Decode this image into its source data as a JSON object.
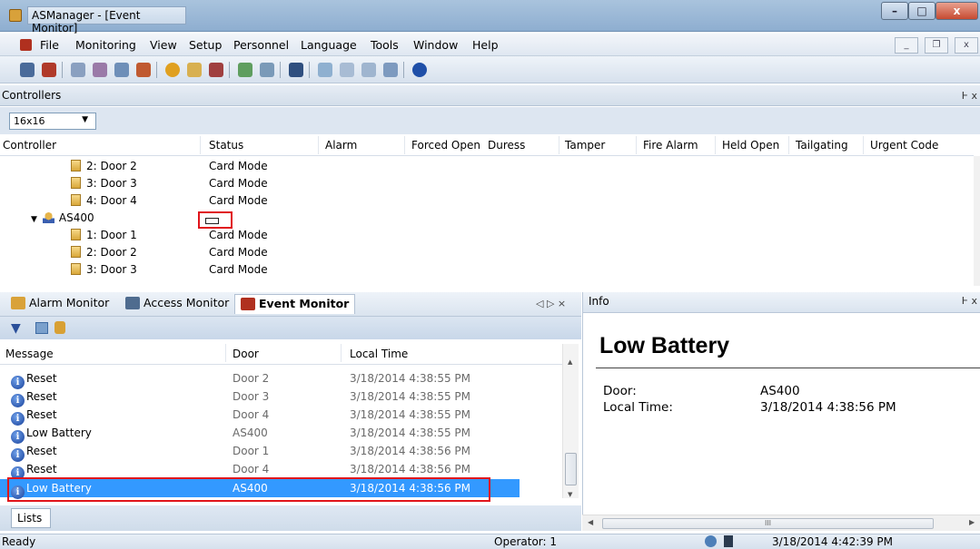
{
  "window": {
    "title": "ASManager - [Event Monitor]",
    "minimize": "–",
    "maximize": "□",
    "close": "x"
  },
  "menu": [
    "File",
    "Monitoring",
    "View",
    "Setup",
    "Personnel",
    "Language",
    "Tools",
    "Window",
    "Help"
  ],
  "mdi_buttons": {
    "minimize": "_",
    "restore": "❐",
    "close": "x"
  },
  "controllers": {
    "title": "Controllers",
    "pin": "Ͱ x",
    "grid_size": "16x16",
    "columns": [
      "Controller",
      "Status",
      "Alarm",
      "Forced Open",
      "Duress",
      "Tamper",
      "Fire Alarm",
      "Held Open",
      "Tailgating",
      "Urgent Code"
    ],
    "rows": [
      {
        "name": "2: Door 2",
        "status": "Card Mode"
      },
      {
        "name": "3: Door 3",
        "status": "Card Mode"
      },
      {
        "name": "4: Door 4",
        "status": "Card Mode"
      },
      {
        "name": "AS400",
        "status": ""
      },
      {
        "name": "1: Door 1",
        "status": "Card Mode"
      },
      {
        "name": "2: Door 2",
        "status": "Card Mode"
      },
      {
        "name": "3: Door 3",
        "status": "Card Mode"
      }
    ]
  },
  "tabs": {
    "alarm": "Alarm Monitor",
    "access": "Access Monitor",
    "event": "Event Monitor",
    "nav": "◁ ▷ ×"
  },
  "events": {
    "columns": [
      "Message",
      "Door",
      "Local Time"
    ],
    "rows": [
      {
        "message": "Reset",
        "door": "Door 2",
        "time": "3/18/2014 4:38:55 PM"
      },
      {
        "message": "Reset",
        "door": "Door 3",
        "time": "3/18/2014 4:38:55 PM"
      },
      {
        "message": "Reset",
        "door": "Door 4",
        "time": "3/18/2014 4:38:55 PM"
      },
      {
        "message": "Low Battery",
        "door": "AS400",
        "time": "3/18/2014 4:38:55 PM"
      },
      {
        "message": "Reset",
        "door": "Door 1",
        "time": "3/18/2014 4:38:56 PM"
      },
      {
        "message": "Reset",
        "door": "Door 4",
        "time": "3/18/2014 4:38:56 PM"
      },
      {
        "message": "Low Battery",
        "door": "AS400",
        "time": "3/18/2014 4:38:56 PM"
      }
    ],
    "lists_tab": "Lists"
  },
  "info": {
    "header": "Info",
    "title": "Low Battery",
    "door_label": "Door:",
    "door_value": "AS400",
    "time_label": "Local Time:",
    "time_value": "3/18/2014 4:38:56 PM",
    "scroll_grip": "III"
  },
  "status": {
    "left": "Ready",
    "operator": "Operator: 1",
    "datetime": "3/18/2014 4:42:39 PM"
  },
  "colors": {
    "selection": "#3399ff",
    "highlight_box": "#e0141b"
  }
}
